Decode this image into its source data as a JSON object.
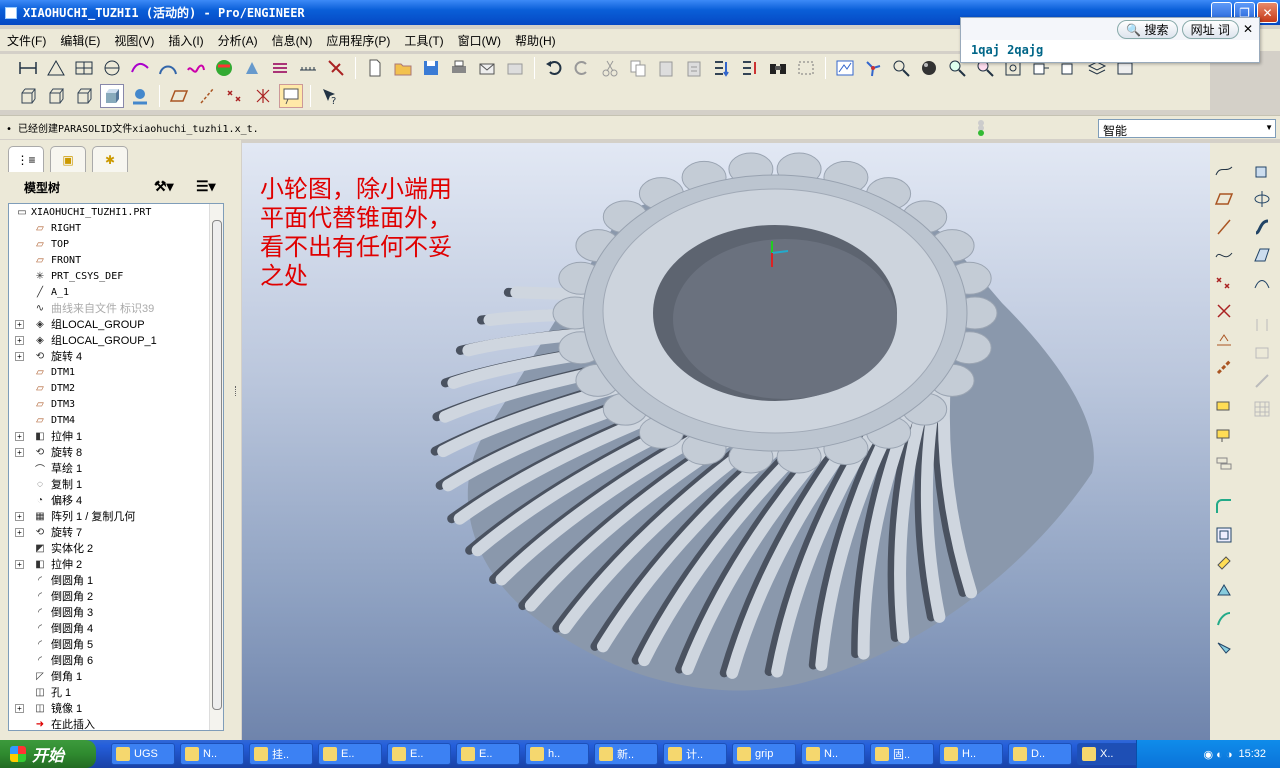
{
  "window": {
    "title": "XIAOHUCHI_TUZHI1 (活动的) - Pro/ENGINEER"
  },
  "menu": [
    "文件(F)",
    "编辑(E)",
    "视图(V)",
    "插入(I)",
    "分析(A)",
    "信息(N)",
    "应用程序(P)",
    "工具(T)",
    "窗口(W)",
    "帮助(H)"
  ],
  "search_popup": {
    "search_label": "搜索",
    "url_label": "网址",
    "word_label": "词",
    "query": "1qaj 2qajg"
  },
  "status": {
    "message": "• 已经创建PARASOLID文件xiaohuchi_tuzhi1.x_t.",
    "filter_value": "智能"
  },
  "left_panel": {
    "header": "模型树",
    "items": [
      {
        "label": "XIAOHUCHI_TUZHI1.PRT",
        "icon": "part-icon",
        "expand": ""
      },
      {
        "label": "RIGHT",
        "icon": "datum-plane-icon",
        "expand": ""
      },
      {
        "label": "TOP",
        "icon": "datum-plane-icon",
        "expand": ""
      },
      {
        "label": "FRONT",
        "icon": "datum-plane-icon",
        "expand": ""
      },
      {
        "label": "PRT_CSYS_DEF",
        "icon": "csys-icon",
        "expand": ""
      },
      {
        "label": "A_1",
        "icon": "axis-icon",
        "expand": ""
      },
      {
        "label": "曲线来自文件 标识39",
        "icon": "curve-icon",
        "expand": ""
      },
      {
        "label": "组LOCAL_GROUP",
        "icon": "group-icon",
        "expand": "+"
      },
      {
        "label": "组LOCAL_GROUP_1",
        "icon": "group-icon",
        "expand": "+"
      },
      {
        "label": "旋转 4",
        "icon": "revolve-icon",
        "expand": "+"
      },
      {
        "label": "DTM1",
        "icon": "datum-plane-icon",
        "expand": ""
      },
      {
        "label": "DTM2",
        "icon": "datum-plane-icon",
        "expand": ""
      },
      {
        "label": "DTM3",
        "icon": "datum-plane-icon",
        "expand": ""
      },
      {
        "label": "DTM4",
        "icon": "datum-plane-icon",
        "expand": ""
      },
      {
        "label": "拉伸 1",
        "icon": "extrude-icon",
        "expand": "+"
      },
      {
        "label": "旋转 8",
        "icon": "revolve-icon",
        "expand": "+"
      },
      {
        "label": "草绘 1",
        "icon": "sketch-icon",
        "expand": ""
      },
      {
        "label": "复制 1",
        "icon": "copy-icon",
        "expand": ""
      },
      {
        "label": "偏移 4",
        "icon": "offset-icon",
        "expand": ""
      },
      {
        "label": "阵列 1 / 复制几何",
        "icon": "pattern-icon",
        "expand": "+"
      },
      {
        "label": "旋转 7",
        "icon": "revolve-icon",
        "expand": "+"
      },
      {
        "label": "实体化 2",
        "icon": "solidify-icon",
        "expand": ""
      },
      {
        "label": "拉伸 2",
        "icon": "extrude-icon",
        "expand": "+"
      },
      {
        "label": "倒圆角 1",
        "icon": "round-icon",
        "expand": ""
      },
      {
        "label": "倒圆角 2",
        "icon": "round-icon",
        "expand": ""
      },
      {
        "label": "倒圆角 3",
        "icon": "round-icon",
        "expand": ""
      },
      {
        "label": "倒圆角 4",
        "icon": "round-icon",
        "expand": ""
      },
      {
        "label": "倒圆角 5",
        "icon": "round-icon",
        "expand": ""
      },
      {
        "label": "倒圆角 6",
        "icon": "round-icon",
        "expand": ""
      },
      {
        "label": "倒角 1",
        "icon": "chamfer-icon",
        "expand": ""
      },
      {
        "label": "孔 1",
        "icon": "hole-icon",
        "expand": ""
      },
      {
        "label": "镜像 1",
        "icon": "mirror-icon",
        "expand": "+"
      },
      {
        "label": "在此插入",
        "icon": "insert-here-icon",
        "expand": ""
      }
    ]
  },
  "viewport": {
    "note": "小轮图，除小端用\n平面代替锥面外，\n看不出有任何不妥\n之处"
  },
  "taskbar": {
    "start_label": "开始",
    "tasks": [
      "UGS",
      "N..",
      "挂..",
      "E..",
      "E..",
      "E..",
      "h..",
      "新..",
      "计..",
      "grip",
      "N..",
      "固..",
      "H..",
      "D..",
      "X.."
    ],
    "clock": "15:32"
  },
  "colors": {
    "titlebar": "#0a5fd8",
    "note_text": "#e00000",
    "gear": "#c4ccd6"
  }
}
